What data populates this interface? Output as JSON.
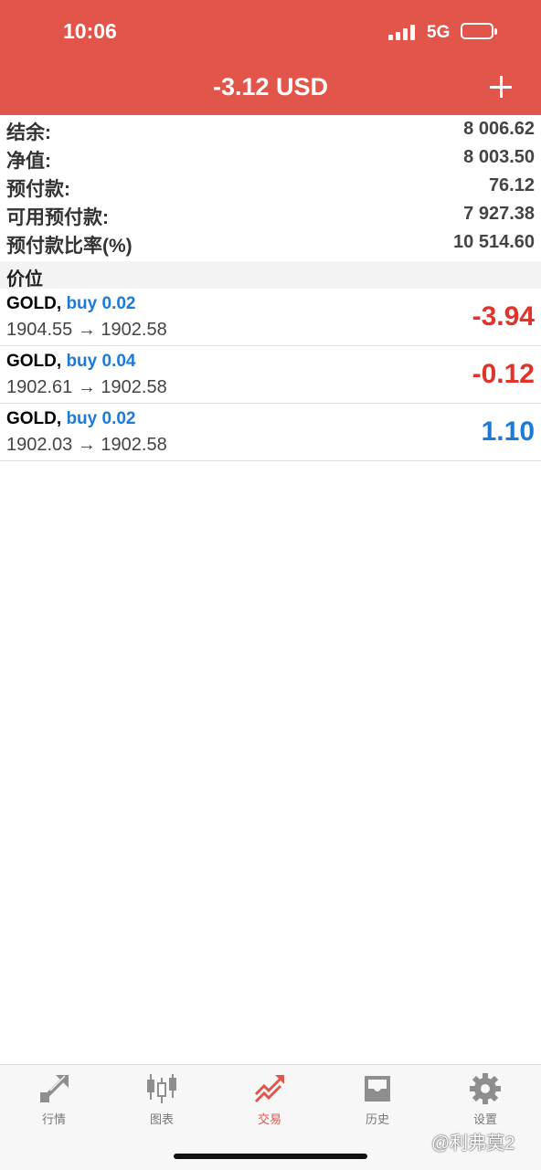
{
  "status_bar": {
    "time": "10:06",
    "network": "5G"
  },
  "header": {
    "title": "-3.12 USD"
  },
  "summary": [
    {
      "label": "结余:",
      "value": "8 006.62"
    },
    {
      "label": "净值:",
      "value": "8 003.50"
    },
    {
      "label": "预付款:",
      "value": "76.12"
    },
    {
      "label": "可用预付款:",
      "value": "7 927.38"
    },
    {
      "label": "预付款比率(%)",
      "value": "10 514.60"
    }
  ],
  "section_title": "价位",
  "positions": [
    {
      "symbol": "GOLD,",
      "side": "buy 0.02",
      "open": "1904.55",
      "arrow": "→",
      "current": "1902.58",
      "profit": "-3.94",
      "profit_color": "#e0342b"
    },
    {
      "symbol": "GOLD,",
      "side": "buy 0.04",
      "open": "1902.61",
      "arrow": "→",
      "current": "1902.58",
      "profit": "-0.12",
      "profit_color": "#e0342b"
    },
    {
      "symbol": "GOLD,",
      "side": "buy 0.02",
      "open": "1902.03",
      "arrow": "→",
      "current": "1902.58",
      "profit": "1.10",
      "profit_color": "#1e7ad9"
    }
  ],
  "tabs": [
    {
      "label": "行情",
      "icon": "quotes-arrows-icon",
      "active": false
    },
    {
      "label": "图表",
      "icon": "candlestick-chart-icon",
      "active": false
    },
    {
      "label": "交易",
      "icon": "trade-trend-icon",
      "active": true
    },
    {
      "label": "历史",
      "icon": "history-tray-icon",
      "active": false
    },
    {
      "label": "设置",
      "icon": "settings-gear-icon",
      "active": false
    }
  ],
  "watermark": "@利弗莫2",
  "colors": {
    "header": "#e2554a",
    "loss": "#e0342b",
    "gain": "#1e7ad9",
    "inactive_tab": "#8e8e8e"
  }
}
